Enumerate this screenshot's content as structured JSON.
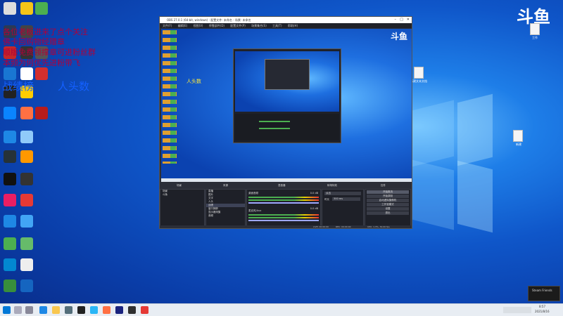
{
  "watermark": {
    "brand": "斗鱼"
  },
  "overlay": {
    "lines": [
      "各位老板进来了点个关注",
      "佛卡回购物经赠章",
      "顺版免费领撑章可进粉丝群",
      "本频为何优先进粉带飞"
    ],
    "stats_label": "战绩榜",
    "heads_label": "人头数",
    "obs_heads_label": "人头数"
  },
  "desktop_right": {
    "file1_label": "工作",
    "file2_label": "新建文本文档",
    "file3_label": "新建",
    "file4_label": "新建文件夹"
  },
  "obs": {
    "title": "OBS 27.0.1 (64-bit, windows) - 配置文件: 未命名 - 场景: 未命名",
    "menu": [
      "文件(F)",
      "编辑(E)",
      "视图(V)",
      "停靠部件(D)",
      "配置文件(P)",
      "场景集合(S)",
      "工具(T)",
      "帮助(H)"
    ],
    "docks": {
      "scenes": "场景",
      "sources": "来源",
      "mixer": "混音器",
      "transitions": "转场特效",
      "controls": "控件"
    },
    "scenes": [
      "场景",
      "斗鱼"
    ],
    "sources": [
      "直播",
      "图片",
      "文字",
      "人头",
      "战绩",
      "窗口捕获",
      "显示器采集",
      "音频"
    ],
    "mixer": [
      {
        "name": "桌面音频",
        "level": "0.0 dB"
      },
      {
        "name": "麦克风/Aux",
        "level": "0.0 dB"
      }
    ],
    "transition": {
      "type": "淡出",
      "duration_label": "时长",
      "duration": "300 ms"
    },
    "controls": [
      "开始推流",
      "开始录制",
      "启动虚拟摄像机",
      "工作室模式",
      "设置",
      "退出"
    ],
    "status": {
      "live": "LIVE: 00:00:00",
      "rec": "REC: 00:00:00",
      "cpu": "CPU: 1.3%, 30.00 fps"
    }
  },
  "taskbar": {
    "time": "8:57",
    "date": "2021/8/16"
  },
  "notify": {
    "title": "Steam Friends"
  }
}
